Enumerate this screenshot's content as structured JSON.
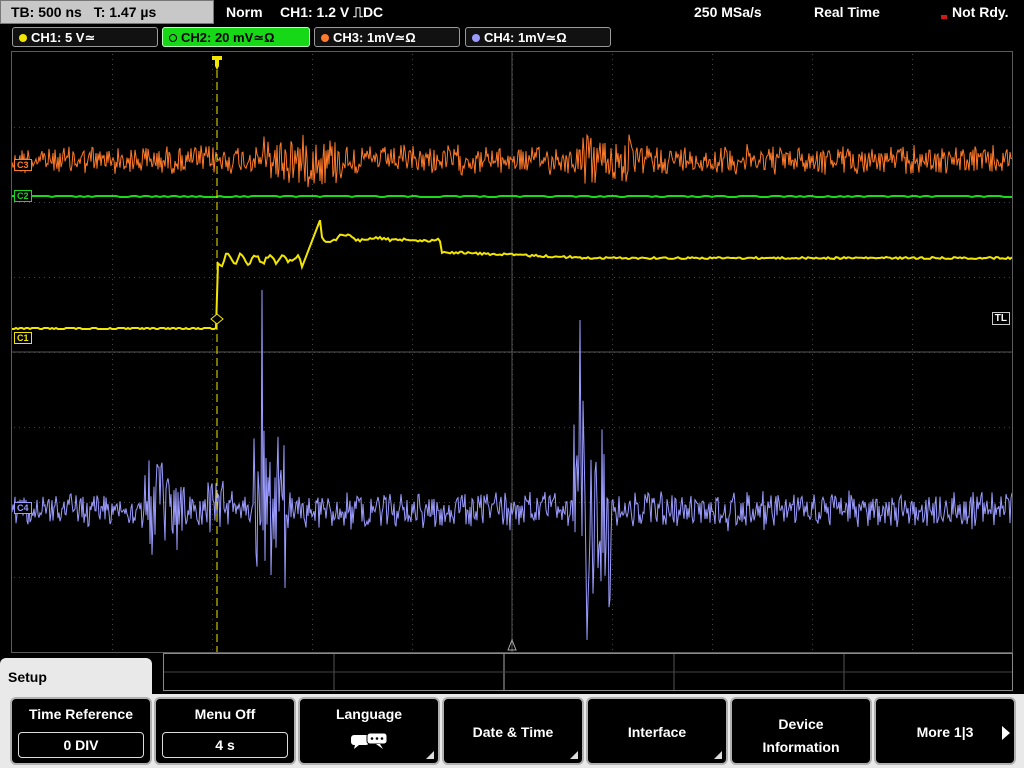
{
  "status": {
    "timebase": "TB: 500 ns",
    "trigger_time": "T: 1.47 µs",
    "mode": "Norm",
    "trigger": "CH1: 1.2 V ⎍DC",
    "sample_rate": "250 MSa/s",
    "acquisition": "Real Time",
    "state": "Not Rdy."
  },
  "channels": [
    {
      "label": "CH1: 5 V≃",
      "color": "#f2e600"
    },
    {
      "label": "CH2: 20 mV≃Ω",
      "color": "#1ad81a",
      "active": true
    },
    {
      "label": "CH3: 1mV≃Ω",
      "color": "#ff7a2a"
    },
    {
      "label": "CH4: 1mV≃Ω",
      "color": "#9b9bff"
    }
  ],
  "markers": {
    "c1": "C1",
    "c2": "C2",
    "c3": "C3",
    "c4": "C4",
    "trigger_level": "TL"
  },
  "menu": {
    "title": "Setup",
    "time_reference": {
      "label": "Time Reference",
      "value": "0 DIV"
    },
    "menu_off": {
      "label": "Menu Off",
      "value": "4 s"
    },
    "language": {
      "label": "Language",
      "icon": "speech-bubbles-icon"
    },
    "date_time": "Date & Time",
    "interface": "Interface",
    "device_info_line1": "Device",
    "device_info_line2": "Information",
    "more": "More 1|3"
  }
}
